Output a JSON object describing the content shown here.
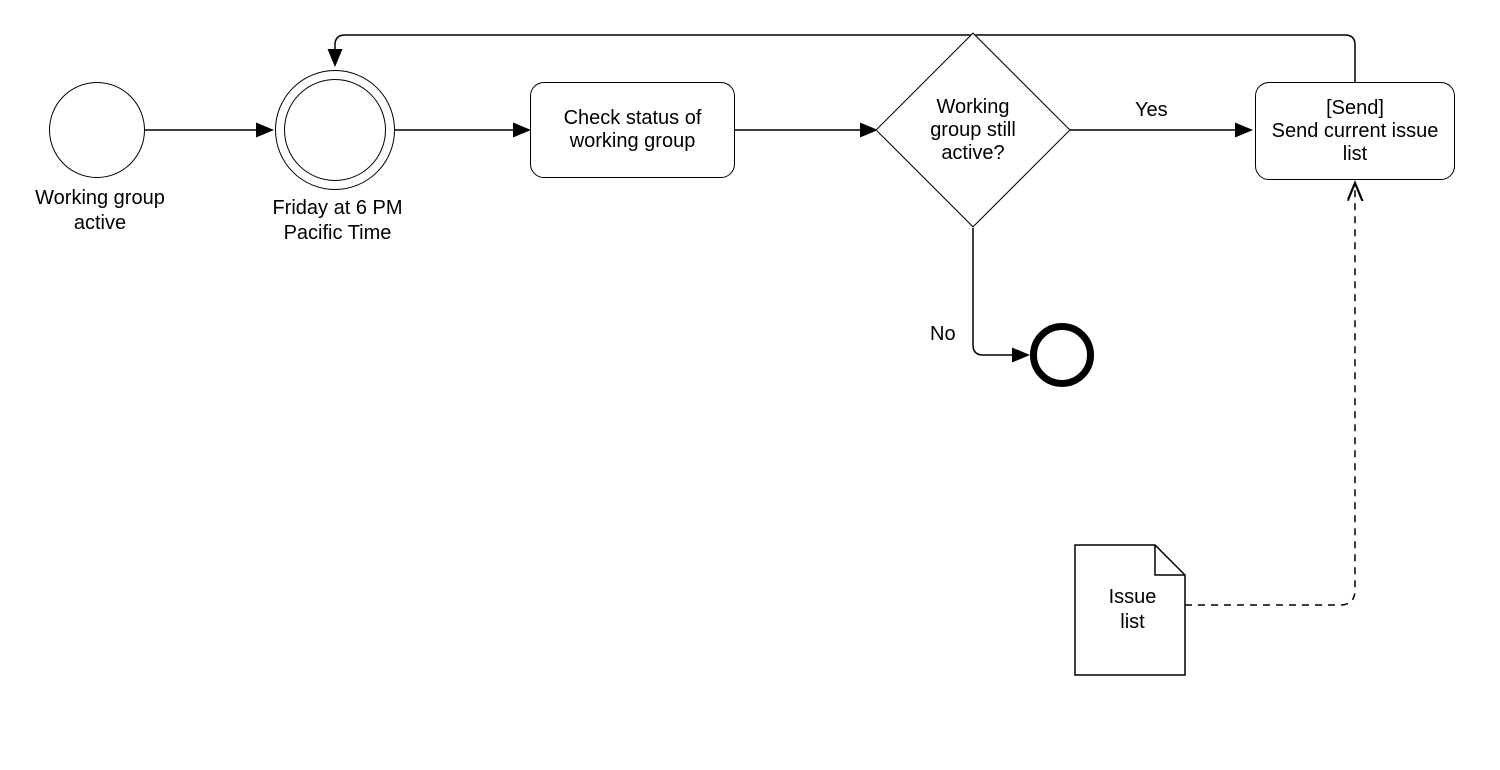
{
  "nodes": {
    "start": {
      "label": "Working group active"
    },
    "timer": {
      "label": "Friday at 6 PM Pacific Time"
    },
    "task_check": {
      "label": "Check status of working group"
    },
    "gateway": {
      "label": "Working group still active?"
    },
    "task_send": {
      "label": "[Send]\nSend current issue list"
    },
    "data_issue": {
      "label": "Issue list"
    }
  },
  "edges": {
    "yes": {
      "label": "Yes"
    },
    "no": {
      "label": "No"
    }
  }
}
